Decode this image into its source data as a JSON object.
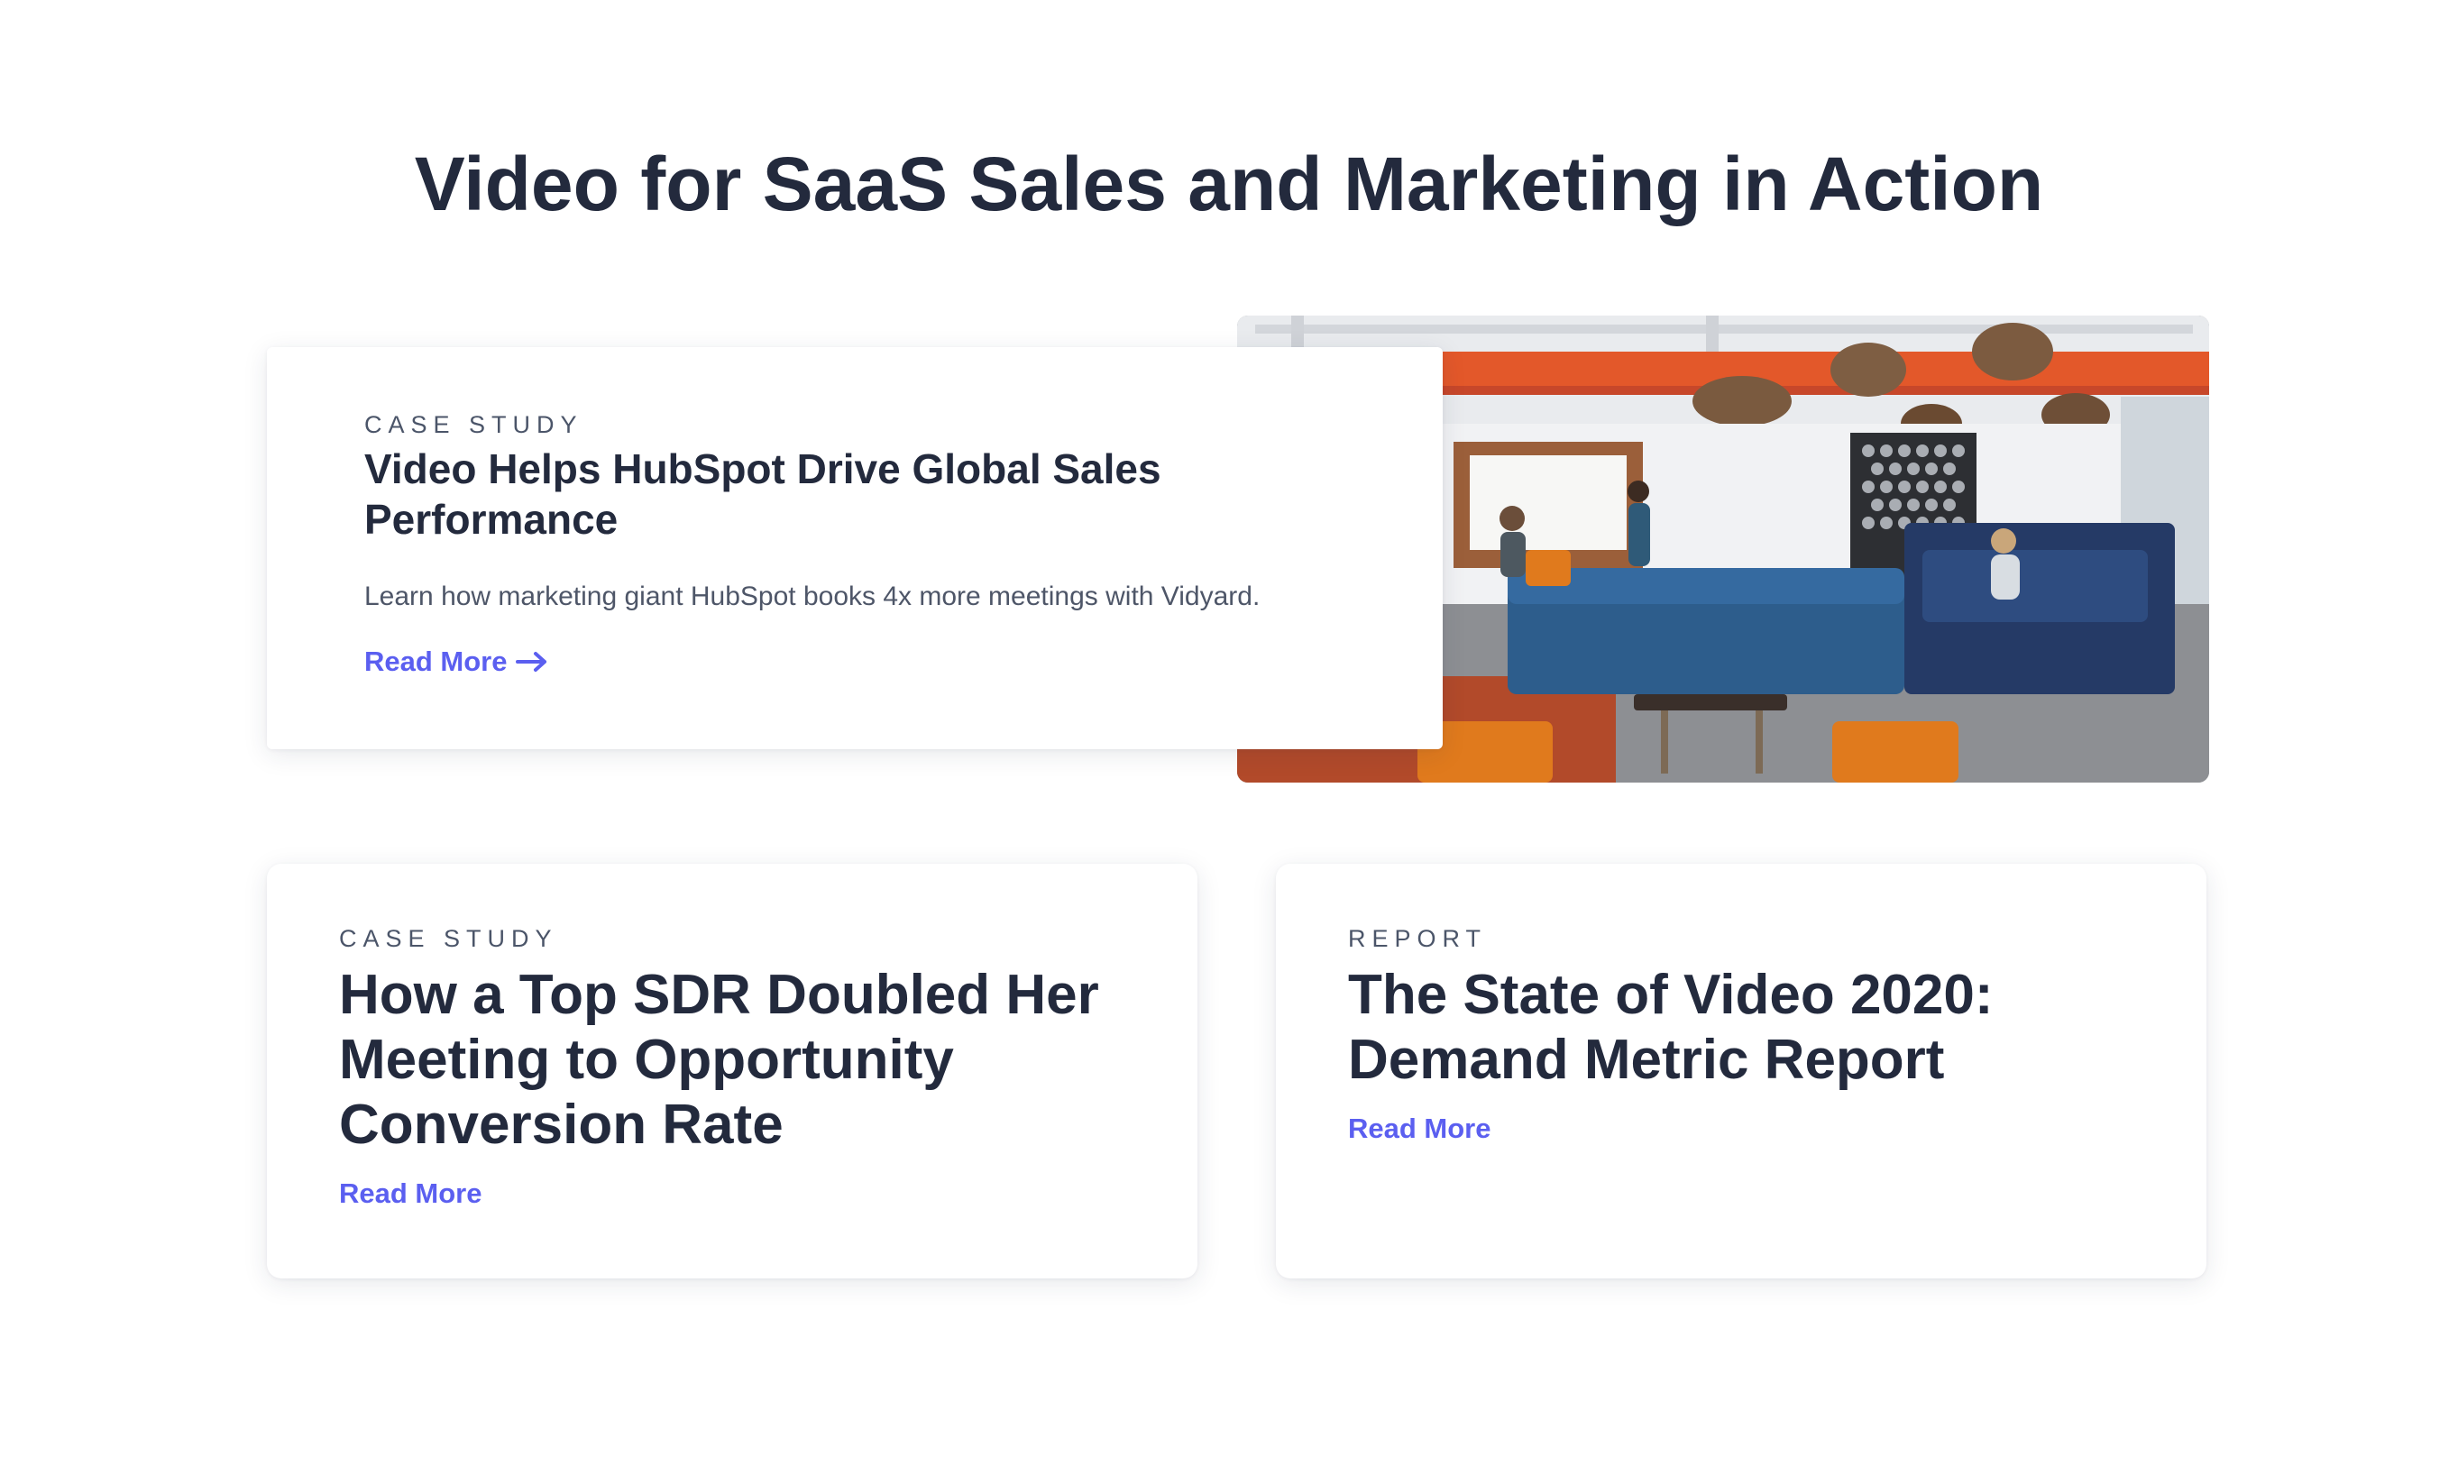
{
  "section": {
    "title": "Video for SaaS Sales and Marketing in Action"
  },
  "featured": {
    "eyebrow": "CASE STUDY",
    "title": "Video Helps HubSpot Drive Global Sales Performance",
    "description": "Learn how marketing giant HubSpot books 4x more meetings with Vidyard.",
    "link_label": "Read More",
    "link_icon": "arrow-right-icon",
    "image_subject": "office lounge photo"
  },
  "cards": [
    {
      "eyebrow": "CASE STUDY",
      "title": "How a Top SDR Doubled Her Meeting to Opportunity Conversion Rate",
      "link_label": "Read More"
    },
    {
      "eyebrow": "REPORT",
      "title": "The State of Video 2020: Demand Metric Report",
      "link_label": "Read More"
    }
  ],
  "colors": {
    "heading": "#232a3d",
    "body": "#4e5668",
    "link": "#5b5ff0",
    "background": "#ffffff"
  }
}
